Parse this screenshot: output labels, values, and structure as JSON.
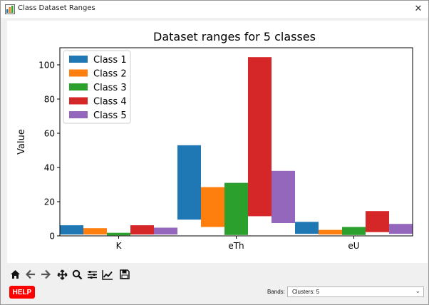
{
  "window": {
    "title": "Class Dataset Ranges",
    "close_glyph": "✕",
    "app_icon": "matplotlib-figure-icon"
  },
  "toolbar": {
    "buttons": [
      {
        "name": "home",
        "icon": "home-icon"
      },
      {
        "name": "back",
        "icon": "back-arrow-icon"
      },
      {
        "name": "forward",
        "icon": "forward-arrow-icon"
      },
      {
        "name": "pan",
        "icon": "move-icon"
      },
      {
        "name": "zoom",
        "icon": "magnifier-icon"
      },
      {
        "name": "subplots",
        "icon": "sliders-icon"
      },
      {
        "name": "edit-axes",
        "icon": "line-chart-icon"
      },
      {
        "name": "save",
        "icon": "floppy-disk-icon"
      }
    ]
  },
  "help": {
    "label": "HELP",
    "color": "#ff0000"
  },
  "bands": {
    "label": "Bands:",
    "selected": "Clusters: 5"
  },
  "chart_data": {
    "type": "bar",
    "title": "Dataset ranges for 5 classes",
    "xlabel": "",
    "ylabel": "Value",
    "categories": [
      "K",
      "eTh",
      "eU"
    ],
    "ylim": [
      0,
      110
    ],
    "yticks": [
      0,
      20,
      40,
      60,
      80,
      100
    ],
    "grid": false,
    "legend_position": "top-left",
    "series": [
      {
        "name": "Class 1",
        "color": "#1f77b4",
        "ranges": [
          [
            0.8,
            6.2
          ],
          [
            9.5,
            53.0
          ],
          [
            1.2,
            8.2
          ]
        ]
      },
      {
        "name": "Class 2",
        "color": "#ff7f0e",
        "ranges": [
          [
            0.8,
            4.5
          ],
          [
            5.2,
            28.5
          ],
          [
            0.8,
            3.5
          ]
        ]
      },
      {
        "name": "Class 3",
        "color": "#2ca02c",
        "ranges": [
          [
            0.3,
            1.8
          ],
          [
            0.5,
            31.0
          ],
          [
            0.5,
            5.2
          ]
        ]
      },
      {
        "name": "Class 4",
        "color": "#d62728",
        "ranges": [
          [
            0.8,
            6.2
          ],
          [
            11.5,
            104.5
          ],
          [
            2.2,
            14.5
          ]
        ]
      },
      {
        "name": "Class 5",
        "color": "#9467bd",
        "ranges": [
          [
            0.8,
            4.8
          ],
          [
            7.5,
            38.0
          ],
          [
            1.2,
            7.0
          ]
        ]
      }
    ]
  }
}
